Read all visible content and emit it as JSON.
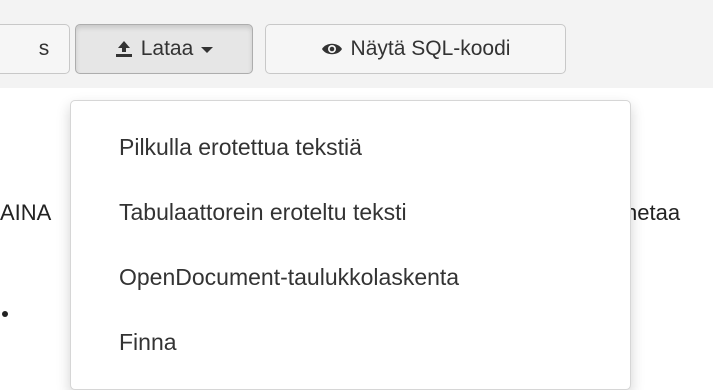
{
  "toolbar": {
    "partial_button_label": "s",
    "download_button_label": "Lataa",
    "sql_button_label": "Näytä SQL-koodi"
  },
  "background": {
    "left_fragment": "AINA",
    "right_fragment": "netaa"
  },
  "dropdown": {
    "items": [
      {
        "label": "Pilkulla erotettua tekstiä"
      },
      {
        "label": "Tabulaattorein eroteltu teksti"
      },
      {
        "label": "OpenDocument-taulukkolaskenta"
      },
      {
        "label": "Finna"
      }
    ]
  },
  "icons": {
    "download": "upload-tray-icon",
    "sql": "eye-icon",
    "caret": "caret-down-icon"
  }
}
